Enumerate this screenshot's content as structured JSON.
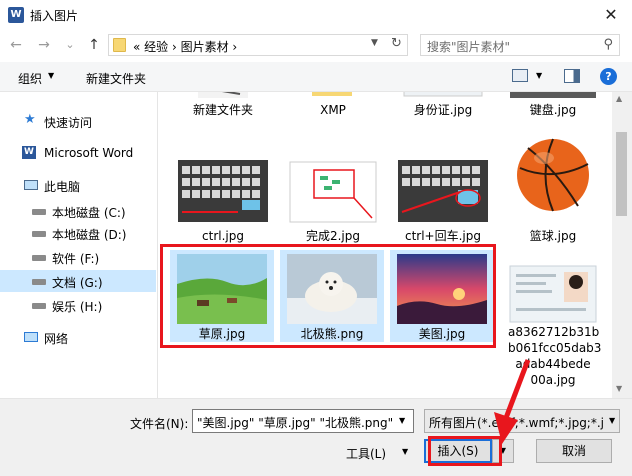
{
  "window": {
    "title": "插入图片",
    "app_icon_letter": "W",
    "close_glyph": "✕"
  },
  "nav": {
    "back": "←",
    "forward": "→",
    "recent": "⌄",
    "up": "↑",
    "address_path": "«  经验  ›  图片素材  ›",
    "search_placeholder": "搜索\"图片素材\""
  },
  "toolbar": {
    "organize_label": "组织",
    "new_folder_label": "新建文件夹"
  },
  "sidebar": {
    "items": [
      {
        "label": "快速访问",
        "icon": "star-icon"
      },
      {
        "label": "Microsoft Word",
        "icon": "word-icon"
      },
      {
        "label": "此电脑",
        "icon": "computer-icon"
      },
      {
        "label": "本地磁盘 (C:)",
        "icon": "drive-icon"
      },
      {
        "label": "本地磁盘 (D:)",
        "icon": "drive-icon"
      },
      {
        "label": "软件 (F:)",
        "icon": "drive-icon"
      },
      {
        "label": "文档 (G:)",
        "icon": "drive-icon",
        "selected": true
      },
      {
        "label": "娱乐 (H:)",
        "icon": "drive-icon"
      },
      {
        "label": "网络",
        "icon": "network-icon"
      }
    ]
  },
  "files": {
    "row0": [
      "新建文件夹",
      "XMP",
      "身份证.jpg",
      "键盘.jpg"
    ],
    "row1": [
      "ctrl.jpg",
      "完成2.jpg",
      "ctrl+回车.jpg",
      "篮球.jpg"
    ],
    "row2": [
      "草原.jpg",
      "北极熊.png",
      "美图.jpg",
      "a8362712b31bb061fcc05dab3adab44bede00a.jpg"
    ],
    "row2_name_lines": [
      "a8362712b31b",
      "b061fcc05dab3",
      "adab44bede",
      "00a.jpg"
    ]
  },
  "bottom": {
    "filename_label": "文件名(N):",
    "filename_value": "\"美图.jpg\" \"草原.jpg\" \"北极熊.png\"",
    "filetype_value": "所有图片(*.emf;*.wmf;*.jpg;*.j",
    "tools_label": "工具(L)",
    "insert_label": "插入(S)",
    "cancel_label": "取消"
  },
  "colors": {
    "selection": "#cce8ff",
    "annotation_red": "#e8161d",
    "accent_blue": "#1a6ed8"
  }
}
